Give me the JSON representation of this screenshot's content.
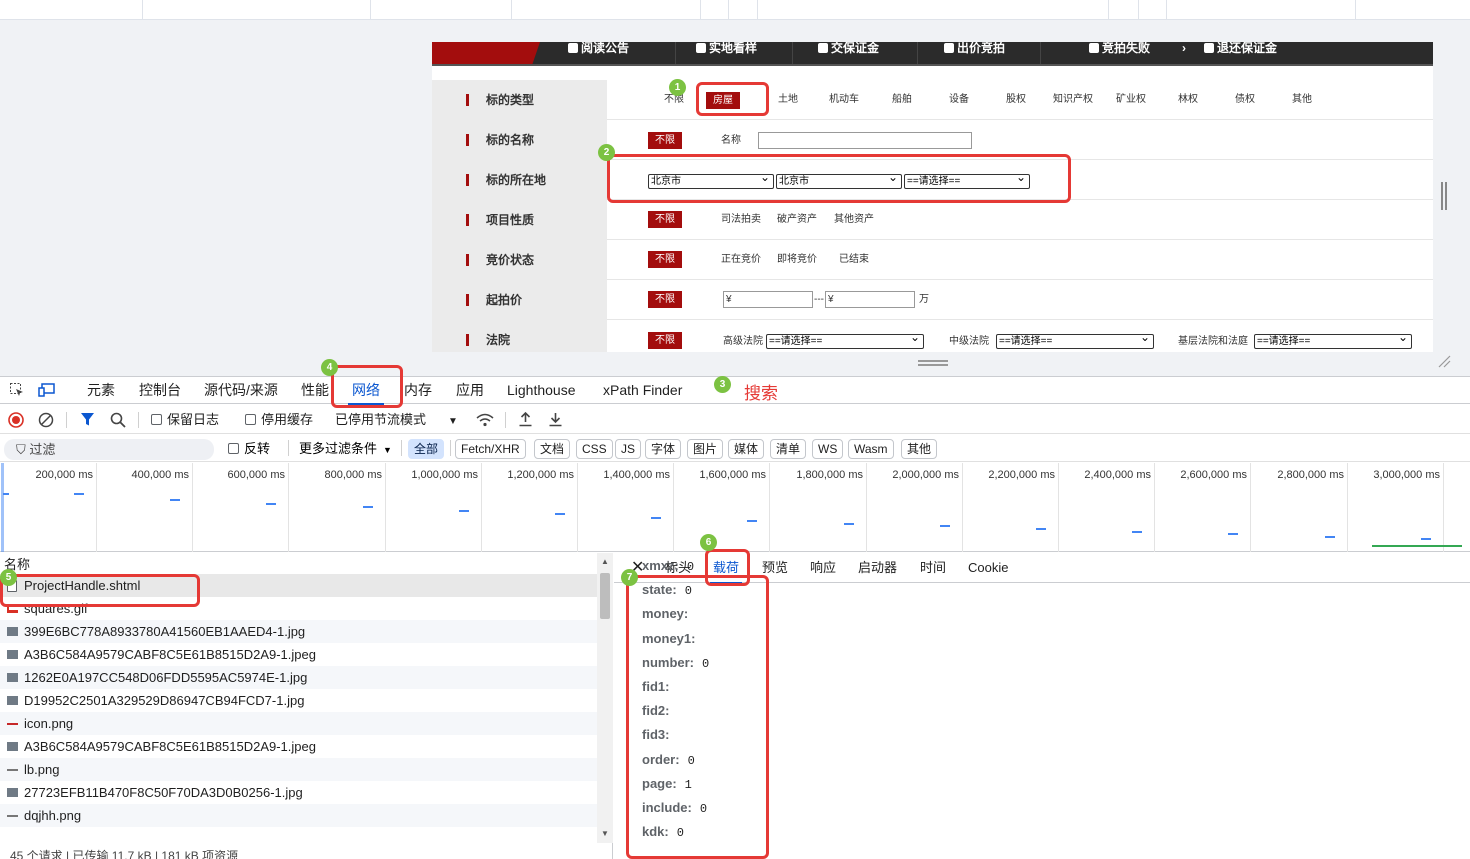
{
  "site": {
    "nav": [
      "阅读公告",
      "实地看样",
      "交保证金",
      "出价竞拍",
      "竞拍失败",
      "退还保证金"
    ],
    "filters": [
      {
        "label": "标的类型",
        "unlimited": "不限",
        "active": "房屋",
        "options": [
          "土地",
          "机动车",
          "船舶",
          "设备",
          "股权",
          "知识产权",
          "矿业权",
          "林权",
          "债权",
          "其他"
        ]
      },
      {
        "label": "标的名称",
        "unlimited": "不限",
        "field_label": "名称"
      },
      {
        "label": "标的所在地",
        "selects": [
          "北京市",
          "北京市",
          "==请选择=="
        ]
      },
      {
        "label": "项目性质",
        "unlimited": "不限",
        "options": [
          "司法拍卖",
          "破产资产",
          "其他资产"
        ]
      },
      {
        "label": "竞价状态",
        "unlimited": "不限",
        "options": [
          "正在竞价",
          "即将竞价",
          "已结束"
        ]
      },
      {
        "label": "起拍价",
        "unlimited": "不限",
        "from": "¥",
        "sep": "---",
        "to": "¥",
        "unit": "万"
      },
      {
        "label": "法院",
        "unlimited": "不限",
        "courts": [
          {
            "label": "高级法院",
            "value": "==请选择=="
          },
          {
            "label": "中级法院",
            "value": "==请选择=="
          },
          {
            "label": "基层法院和法庭",
            "value": "==请选择=="
          }
        ]
      }
    ]
  },
  "annotations": {
    "badges": [
      "1",
      "2",
      "3",
      "4",
      "5",
      "6",
      "7"
    ],
    "search_note": "搜索"
  },
  "devtools": {
    "tabs": [
      "元素",
      "控制台",
      "源代码/来源",
      "性能",
      "网络",
      "内存",
      "应用",
      "Lighthouse",
      "xPath Finder"
    ],
    "toolbar": {
      "preserve_log": "保留日志",
      "disable_cache": "停用缓存",
      "throttle": "已停用节流模式"
    },
    "filter": {
      "placeholder": "过滤",
      "invert": "反转",
      "more": "更多过滤条件"
    },
    "type_chips": [
      "全部",
      "Fetch/XHR",
      "文档",
      "CSS",
      "JS",
      "字体",
      "图片",
      "媒体",
      "清单",
      "WS",
      "Wasm",
      "其他"
    ],
    "timeline_ticks": [
      "200,000 ms",
      "400,000 ms",
      "600,000 ms",
      "800,000 ms",
      "1,000,000 ms",
      "1,200,000 ms",
      "1,400,000 ms",
      "1,600,000 ms",
      "1,800,000 ms",
      "2,000,000 ms",
      "2,200,000 ms",
      "2,400,000 ms",
      "2,600,000 ms",
      "2,800,000 ms",
      "3,000,000 ms"
    ],
    "list_header": "名称",
    "requests": [
      {
        "name": "ProjectHandle.shtml",
        "icon": "document-icon"
      },
      {
        "name": "squares.gif",
        "icon": "gif-icon"
      },
      {
        "name": "399E6BC778A8933780A41560EB1AAED4-1.jpg",
        "icon": "image-icon"
      },
      {
        "name": "A3B6C584A9579CABF8C5E61B8515D2A9-1.jpeg",
        "icon": "image-icon"
      },
      {
        "name": "1262E0A197CC548D06FDD5595AC5974E-1.jpg",
        "icon": "image-icon"
      },
      {
        "name": "D19952C2501A329529D86947CB94FCD7-1.jpg",
        "icon": "image-icon"
      },
      {
        "name": "icon.png",
        "icon": "image-icon"
      },
      {
        "name": "A3B6C584A9579CABF8C5E61B8515D2A9-1.jpeg",
        "icon": "image-icon"
      },
      {
        "name": "lb.png",
        "icon": "image-icon"
      },
      {
        "name": "27723EFB11B470F8C50F70DA3D0B0256-1.jpg",
        "icon": "image-icon"
      },
      {
        "name": "dqjhh.png",
        "icon": "image-icon"
      }
    ],
    "status": "45 个请求 | 已传输 11.7 kB | 181 kB 项资源",
    "detail_tabs": [
      "标头",
      "载荷",
      "预览",
      "响应",
      "启动器",
      "时间",
      "Cookie"
    ],
    "payload": [
      {
        "key": "xmxz:",
        "value": "0"
      },
      {
        "key": "state:",
        "value": "0"
      },
      {
        "key": "money:",
        "value": ""
      },
      {
        "key": "money1:",
        "value": ""
      },
      {
        "key": "number:",
        "value": "0"
      },
      {
        "key": "fid1:",
        "value": ""
      },
      {
        "key": "fid2:",
        "value": ""
      },
      {
        "key": "fid3:",
        "value": ""
      },
      {
        "key": "order:",
        "value": "0"
      },
      {
        "key": "page:",
        "value": "1"
      },
      {
        "key": "include:",
        "value": "0"
      },
      {
        "key": "kdk:",
        "value": "0"
      }
    ],
    "colors": {
      "accent": "#0b57d0",
      "highlight": "#e53935",
      "badge": "#7cc242",
      "site_red": "#a30d0d"
    }
  }
}
